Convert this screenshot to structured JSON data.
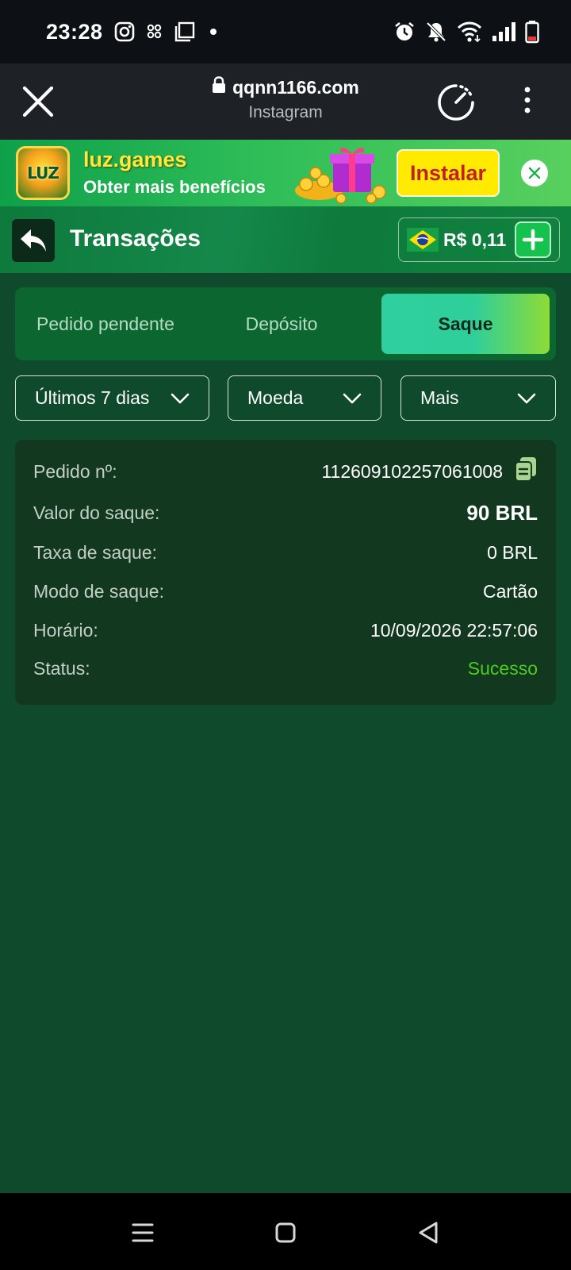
{
  "status_bar": {
    "time": "23:28",
    "icons_left": [
      "instagram-icon",
      "grid-dots-icon",
      "square-icon",
      "dot-icon"
    ],
    "icons_right": [
      "alarm-icon",
      "bell-off-icon",
      "wifi-icon",
      "signal-icon",
      "battery-icon"
    ]
  },
  "browser": {
    "url": "qqnn1166.com",
    "subtitle": "Instagram"
  },
  "install_banner": {
    "app_logo_text": "LUZ",
    "title": "luz.games",
    "subtitle": "Obter mais benefícios",
    "install_label": "Instalar"
  },
  "header": {
    "title": "Transações",
    "balance": "R$ 0,11"
  },
  "tabs": [
    {
      "label": "Pedido pendente",
      "active": false
    },
    {
      "label": "Depósito",
      "active": false
    },
    {
      "label": "Saque",
      "active": true
    }
  ],
  "filters": [
    {
      "label": "Últimos 7 dias"
    },
    {
      "label": "Moeda"
    },
    {
      "label": "Mais"
    }
  ],
  "transaction": {
    "order_no_label": "Pedido nº:",
    "order_no": "112609102257061008",
    "amount_label": "Valor do saque:",
    "amount": "90 BRL",
    "fee_label": "Taxa de saque:",
    "fee": "0 BRL",
    "mode_label": "Modo de saque:",
    "mode": "Cartão",
    "time_label": "Horário:",
    "time": "10/09/2026 22:57:06",
    "status_label": "Status:",
    "status": "Sucesso"
  },
  "colors": {
    "background": "#0f4a2c",
    "header": "#0e7a3c",
    "success": "#4ecb1f",
    "install_button": "#ffea00"
  }
}
